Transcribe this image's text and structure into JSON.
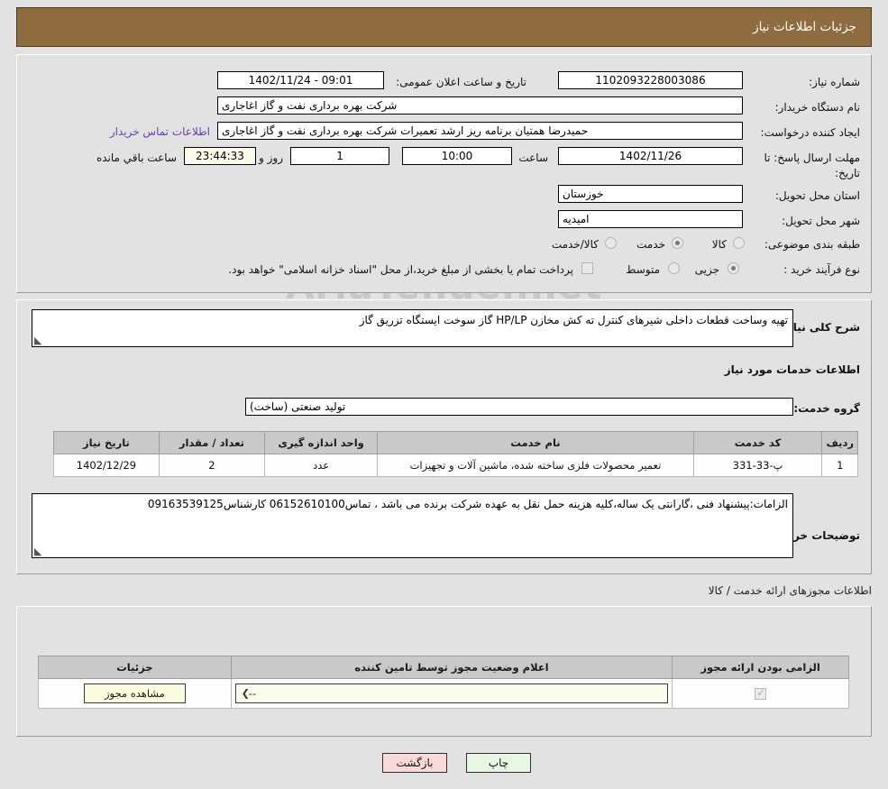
{
  "header": {
    "title": "جزئیات اطلاعات نیاز"
  },
  "top": {
    "need_number_label": "شماره نیاز:",
    "need_number_value": "1102093228003086",
    "announce_label": "تاریخ و ساعت اعلان عمومی:",
    "announce_value": "09:01 - 1402/11/24",
    "buyer_org_label": "نام دستگاه خریدار:",
    "buyer_org_value": "شرکت بهره برداری نفت و گاز اغاجاری",
    "creator_label": "ایجاد کننده درخواست:",
    "creator_value": "حمیدرضا همتیان برنامه ریز ارشد تعمیرات شرکت بهره برداری نفت و گاز اغاجاری",
    "contact_link": "اطلاعات تماس خریدار",
    "deadline_label": "مهلت ارسال پاسخ: تا تاریخ:",
    "deadline_date": "1402/11/26",
    "hour_label": "ساعت",
    "hour_value": "10:00",
    "days_value": "1",
    "days_label": "روز و",
    "countdown_value": "23:44:33",
    "countdown_label": "ساعت باقي مانده",
    "province_label": "استان محل تحویل:",
    "province_value": "خوزستان",
    "city_label": "شهر محل تحویل:",
    "city_value": "امیدیه",
    "category_label": "طبقه بندی موضوعی:",
    "category_options": [
      "کالا",
      "خدمت",
      "کالا/خدمت"
    ],
    "category_selected": 1,
    "process_label": "نوع فرآیند خرید :",
    "process_options": [
      "جزیی",
      "متوسط"
    ],
    "process_selected": 0,
    "treasury_checkbox_text": "پرداخت تمام یا بخشی از مبلغ خرید،از محل \"اسناد خزانه اسلامی\" خواهد بود.",
    "treasury_checked": false
  },
  "middle": {
    "summary_label": "شرح کلی نیاز:",
    "summary_value": "تهیه وساخت قطعات داخلی شیرهای کنترل ته کش مخازن HP/LP گاز سوخت ایستگاه تزریق گاز",
    "services_heading": "اطلاعات خدمات مورد نیاز",
    "service_group_label": "گروه خدمت:",
    "service_group_value": "تولید صنعتی (ساخت)",
    "table_headers": [
      "ردیف",
      "کد خدمت",
      "نام خدمت",
      "واحد اندازه گیری",
      "تعداد / مقدار",
      "تاریخ نیاز"
    ],
    "table_rows": [
      {
        "row": "1",
        "code": "پ-33-331",
        "name": "تعمیر محصولات فلزی ساخته شده، ماشین آلات و تجهیزات",
        "unit": "عدد",
        "qty": "2",
        "date": "1402/12/29"
      }
    ],
    "notes_label": "توضیحات خریدار:",
    "notes_value": "الزامات:پیشنهاد فنی ،گارانتی یک ساله،کلیه هزینه حمل نقل به عهده شرکت برنده می باشد ، تماس06152610100 کارشناس09163539125"
  },
  "permits": {
    "caption": "اطلاعات مجوزهای ارائه خدمت / کالا",
    "headers": [
      "الزامی بودن ارائه مجوز",
      "اعلام وضعیت مجوز توسط تامین کننده",
      "جزئیات"
    ],
    "rows": [
      {
        "required_checked": true,
        "status_value": "--",
        "details_button": "مشاهده مجوز"
      }
    ]
  },
  "footer": {
    "print_label": "چاپ",
    "back_label": "بازگشت"
  },
  "watermark": {
    "text": "AriaTender.net"
  },
  "colors": {
    "header_bg": "#8f6c3f",
    "page_bg": "#e2e2e2",
    "link": "#6a3fae",
    "countdown_bg": "#fbfbe8",
    "print_btn": "#e7f7e4",
    "back_btn": "#fad9d9",
    "select_bg": "#fbfbeb"
  }
}
